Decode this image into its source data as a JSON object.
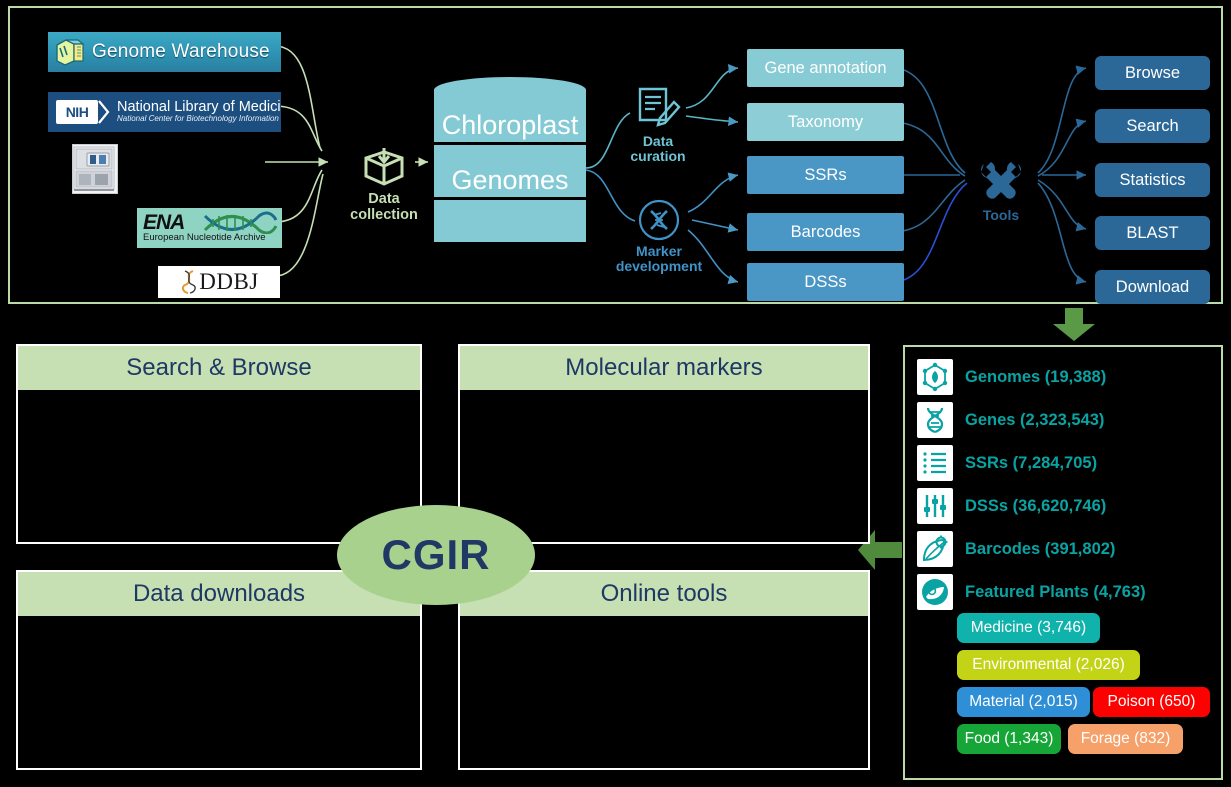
{
  "top_panel": {
    "sources": [
      {
        "name": "genome-warehouse",
        "label": "Genome Warehouse",
        "icon": "cube-logo-icon"
      },
      {
        "name": "nih-nlm",
        "badge": "NIH",
        "line1": "National Library of Medicine",
        "line2": "National Center for Biotechnology Information"
      },
      {
        "name": "sequencer",
        "icon": "sequencer-machine-icon"
      },
      {
        "name": "ena",
        "label": "ENA",
        "sub": "European Nucleotide Archive",
        "icon": "dna-helix-icon"
      },
      {
        "name": "ddbj",
        "label": "DDBJ",
        "icon": "dna-helix-orange-icon"
      }
    ],
    "data_collection": {
      "label_line1": "Data",
      "label_line2": "collection",
      "icon": "box-download-icon"
    },
    "database": {
      "line1": "Chloroplast",
      "line2": "Genomes"
    },
    "processes": [
      {
        "name": "data-curation",
        "label_line1": "Data",
        "label_line2": "curation",
        "icon": "document-pencil-icon"
      },
      {
        "name": "marker-development",
        "label_line1": "Marker",
        "label_line2": "development",
        "icon": "dna-circle-icon"
      }
    ],
    "middle_boxes": [
      {
        "label": "Gene annotation",
        "color": "#87ccd4"
      },
      {
        "label": "Taxonomy",
        "color": "#8ccdd6"
      },
      {
        "label": "SSRs",
        "color": "#4a96c4"
      },
      {
        "label": "Barcodes",
        "color": "#4a96c4"
      },
      {
        "label": "DSSs",
        "color": "#4a96c4"
      }
    ],
    "tools": {
      "label": "Tools",
      "icon": "wrench-screwdriver-icon"
    },
    "right_boxes": [
      {
        "label": "Browse"
      },
      {
        "label": "Search"
      },
      {
        "label": "Statistics"
      },
      {
        "label": "BLAST"
      },
      {
        "label": "Download"
      }
    ]
  },
  "portal": {
    "center_label": "CGIR",
    "quadrants": [
      {
        "name": "search-browse",
        "title": "Search & Browse"
      },
      {
        "name": "molecular-markers",
        "title": "Molecular markers"
      },
      {
        "name": "data-downloads",
        "title": "Data downloads"
      },
      {
        "name": "online-tools",
        "title": "Online tools"
      }
    ]
  },
  "stats": {
    "items": [
      {
        "label": "Genomes (19,388)",
        "icon": "genome-hexagon-icon"
      },
      {
        "label": "Genes (2,323,543)",
        "icon": "dna-helix-icon"
      },
      {
        "label": "SSRs (7,284,705)",
        "icon": "list-lines-icon"
      },
      {
        "label": "DSSs (36,620,746)",
        "icon": "sliders-icon"
      },
      {
        "label": "Barcodes (391,802)",
        "icon": "leaf-gear-icon"
      },
      {
        "label": "Featured Plants (4,763)",
        "icon": "plant-badge-icon"
      }
    ],
    "chips": [
      {
        "label": "Medicine (3,746)",
        "color": "#10b3ab"
      },
      {
        "label": "Environmental (2,026)",
        "color": "#c3d416"
      },
      {
        "label": "Material (2,015)",
        "color": "#2e8fd6"
      },
      {
        "label": "Poison (650)",
        "color": "#fe0000"
      },
      {
        "label": "Food (1,343)",
        "color": "#16a637"
      },
      {
        "label": "Forage (832)",
        "color": "#f6a16a"
      }
    ]
  },
  "colors": {
    "panel_border": "#bcd9a8",
    "flow_green": "#c6dfb4",
    "arrow_green": "#5a9a47",
    "header_green": "#c6e0b4",
    "navy": "#1f3864",
    "teal": "#0aa3a3",
    "steel_blue": "#2b6898"
  }
}
